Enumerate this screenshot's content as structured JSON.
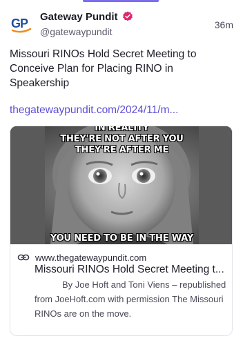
{
  "post": {
    "author_name": "Gateway Pundit",
    "author_handle": "@gatewaypundit",
    "avatar_text": "GP",
    "timestamp": "36m",
    "text": "Missouri RINOs Hold Secret Meeting to Conceive Plan for Placing RINO in Speakership",
    "link_text": "thegatewaypundit.com/2024/11/m..."
  },
  "card": {
    "image_top_text_line1": "IN REALITY",
    "image_top_text_line2": "THEY'RE NOT AFTER YOU",
    "image_top_text_line3": "THEY'RE AFTER ME",
    "image_bottom_text": "YOU NEED TO BE IN THE WAY",
    "domain": "www.thegatewaypundit.com",
    "title": "Missouri RINOs Hold Secret Meeting t...",
    "description": "By Joe Hoft and Toni Viens – republished from JoeHoft.com with permission The Missouri RINOs are on the move."
  },
  "icons": {
    "verified": "verified-badge-icon",
    "link": "link-chain-icon"
  },
  "colors": {
    "accent": "#7c6cf0",
    "link": "#5b4ed6",
    "verified": "#e0256f",
    "avatar_blue": "#1f4fa0",
    "avatar_orange": "#f08a1c"
  }
}
